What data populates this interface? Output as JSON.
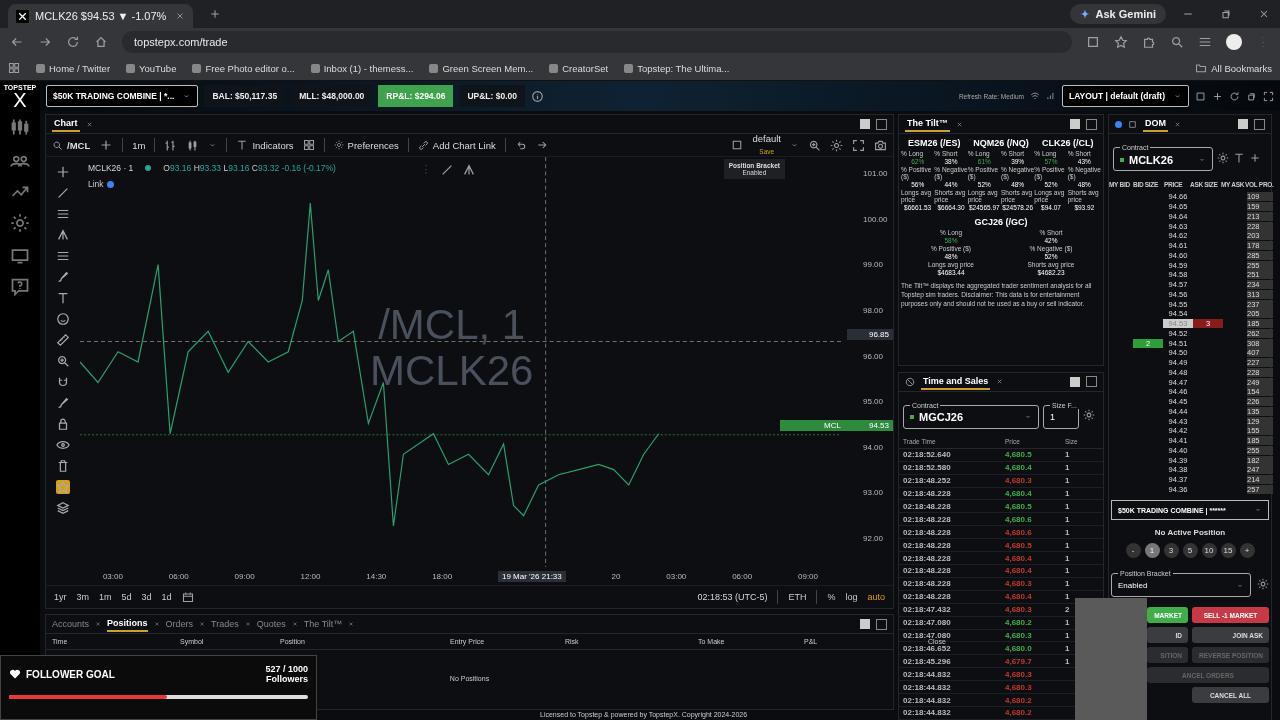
{
  "browser": {
    "tab_title": "MCLK26 $94.53 ▼ -1.07%",
    "ask_button": "Ask Gemini",
    "url": "topstepx.com/trade",
    "bookmarks": [
      "Home / Twitter",
      "YouTube",
      "Free Photo editor o...",
      "Inbox (1) - themess...",
      "Green Screen Mem...",
      "CreatorSet",
      "Topstep: The Ultima..."
    ],
    "all_bookmarks": "All Bookmarks"
  },
  "app_header": {
    "logo_word": "TOPSTEP",
    "logo_letter": "X",
    "account_select": "$50K TRADING COMBINE | *...",
    "stats": [
      {
        "text": "BAL: $50,117.35",
        "kind": "plain"
      },
      {
        "text": "MLL: $48,000.00",
        "kind": "plain"
      },
      {
        "text": "RP&L: $294.06",
        "kind": "positive"
      },
      {
        "text": "UP&L: $0.00",
        "kind": "plain"
      }
    ],
    "refresh_rate": "Refresh Rate: Medium",
    "layout_select": "LAYOUT | default (draft)"
  },
  "chart_panel": {
    "tab": "Chart",
    "symbol": "/MCL",
    "interval": "1m",
    "indicators": "Indicators",
    "preferences": "Preferences",
    "add_link": "Add Chart Link",
    "layout": "default",
    "save": "Save",
    "legend_title": "MCLK26 · 1",
    "ohlc": [
      {
        "label": "O",
        "value": "93.16"
      },
      {
        "label": "H",
        "value": "93.33"
      },
      {
        "label": "L",
        "value": "93.16"
      },
      {
        "label": "C",
        "value": "93.32"
      }
    ],
    "change": "-0.16 (-0.17%)",
    "link": "Link",
    "watermark": [
      "/MCL, 1",
      "MCLK26"
    ],
    "tooltip_title": "Position Bracket",
    "tooltip_value": "Enabled",
    "price_axis": [
      "101.00",
      "100.00",
      "99.00",
      "98.00",
      "96.00",
      "95.00",
      "94.00",
      "93.00",
      "92.00"
    ],
    "crosshair_price": "96.85",
    "last_symbol": "MCL",
    "last_price": "94.53",
    "time_axis": [
      "03:00",
      "06:00",
      "09:00",
      "12:00",
      "14:30",
      "18:00",
      "20",
      "03:00",
      "06:00",
      "09:00"
    ],
    "crosshair_time": "19 Mar '26   21:33",
    "ranges": [
      "1yr",
      "3m",
      "1m",
      "5d",
      "3d",
      "1d"
    ],
    "clock": "02:18:53 (UTC-5)",
    "session": "ETH",
    "scale_options": [
      {
        "label": "%",
        "selected": false
      },
      {
        "label": "log",
        "selected": false
      },
      {
        "label": "auto",
        "selected": true
      }
    ]
  },
  "bottom_panel": {
    "tabs": [
      {
        "label": "Accounts",
        "selected": false
      },
      {
        "label": "Positions",
        "selected": true
      },
      {
        "label": "Orders",
        "selected": false
      },
      {
        "label": "Trades",
        "selected": false
      },
      {
        "label": "Quotes",
        "selected": false
      },
      {
        "label": "The Tilt™",
        "selected": false
      }
    ],
    "columns": [
      "Time",
      "Symbol",
      "Position",
      "Entry Price",
      "Risk",
      "To Make",
      "P&L",
      "Close"
    ],
    "empty": "No Positions"
  },
  "follower_goal": {
    "title": "FOLLOWER GOAL",
    "count": "527 / 1000",
    "unit": "Followers",
    "level": 0.527
  },
  "tilt": {
    "title": "The Tilt™",
    "markets": [
      {
        "ticker": "ESM26 (/ES)",
        "stats": [
          {
            "label": "% Long",
            "value": "62%",
            "kind": "long"
          },
          {
            "label": "% Short",
            "value": "38%",
            "kind": "plain"
          },
          {
            "label": "% Positive ($)",
            "value": "56%",
            "kind": "plain"
          },
          {
            "label": "% Negative ($)",
            "value": "44%",
            "kind": "plain"
          },
          {
            "label": "Longs avg price",
            "value": "$6661.53",
            "kind": "plain"
          },
          {
            "label": "Shorts avg price",
            "value": "$6664.30",
            "kind": "plain"
          }
        ]
      },
      {
        "ticker": "NQM26 (/NQ)",
        "stats": [
          {
            "label": "% Long",
            "value": "61%",
            "kind": "long"
          },
          {
            "label": "% Short",
            "value": "39%",
            "kind": "plain"
          },
          {
            "label": "% Positive ($)",
            "value": "52%",
            "kind": "plain"
          },
          {
            "label": "% Negative ($)",
            "value": "48%",
            "kind": "plain"
          },
          {
            "label": "Longs avg price",
            "value": "$24565.97",
            "kind": "plain"
          },
          {
            "label": "Shorts avg price",
            "value": "$24578.26",
            "kind": "plain"
          }
        ]
      },
      {
        "ticker": "CLK26 (/CL)",
        "stats": [
          {
            "label": "% Long",
            "value": "57%",
            "kind": "long"
          },
          {
            "label": "% Short",
            "value": "43%",
            "kind": "plain"
          },
          {
            "label": "% Positive ($)",
            "value": "52%",
            "kind": "plain"
          },
          {
            "label": "% Negative ($)",
            "value": "48%",
            "kind": "plain"
          },
          {
            "label": "Longs avg price",
            "value": "$94.07",
            "kind": "plain"
          },
          {
            "label": "Shorts avg price",
            "value": "$93.92",
            "kind": "plain"
          }
        ]
      },
      {
        "ticker": "GCJ26 (/GC)",
        "stats": [
          {
            "label": "% Long",
            "value": "58%",
            "kind": "long"
          },
          {
            "label": "% Short",
            "value": "42%",
            "kind": "plain"
          },
          {
            "label": "% Positive ($)",
            "value": "48%",
            "kind": "plain"
          },
          {
            "label": "% Negative ($)",
            "value": "52%",
            "kind": "plain"
          },
          {
            "label": "Longs avg price",
            "value": "$4683.44",
            "kind": "plain"
          },
          {
            "label": "Shorts avg price",
            "value": "$4682.23",
            "kind": "plain"
          }
        ]
      }
    ],
    "disclaimer": "The Tilt™ displays the aggregated trader sentiment analysis for all Topstep sim traders. Disclaimer: This data is for entertainment purposes only and should not be used as a buy or sell indicator."
  },
  "time_and_sales": {
    "title": "Time and Sales",
    "contract_label": "Contract",
    "contract": "MGCJ26",
    "size_label": "Size F...",
    "size": "1",
    "columns": [
      "Trade Time",
      "Price",
      "Size"
    ],
    "rows": [
      {
        "time": "02:18:52.640",
        "price": "4,680.5",
        "size": "1",
        "color": "#3fae49"
      },
      {
        "time": "02:18:52.580",
        "price": "4,680.4",
        "size": "1",
        "color": "#3fae49"
      },
      {
        "time": "02:18:48.252",
        "price": "4,680.3",
        "size": "1",
        "color": "#c0392b"
      },
      {
        "time": "02:18:48.228",
        "price": "4,680.4",
        "size": "1",
        "color": "#3fae49"
      },
      {
        "time": "02:18:48.228",
        "price": "4,680.5",
        "size": "1",
        "color": "#3fae49"
      },
      {
        "time": "02:18:48.228",
        "price": "4,680.6",
        "size": "1",
        "color": "#3fae49"
      },
      {
        "time": "02:18:48.228",
        "price": "4,680.6",
        "size": "1",
        "color": "#c0392b"
      },
      {
        "time": "02:18:48.228",
        "price": "4,680.5",
        "size": "1",
        "color": "#c0392b"
      },
      {
        "time": "02:18:48.228",
        "price": "4,680.4",
        "size": "1",
        "color": "#c0392b"
      },
      {
        "time": "02:18:48.228",
        "price": "4,680.4",
        "size": "1",
        "color": "#c0392b"
      },
      {
        "time": "02:18:48.228",
        "price": "4,680.3",
        "size": "1",
        "color": "#c0392b"
      },
      {
        "time": "02:18:48.228",
        "price": "4,680.4",
        "size": "1",
        "color": "#c0392b"
      },
      {
        "time": "02:18:47.432",
        "price": "4,680.3",
        "size": "2",
        "color": "#c0392b"
      },
      {
        "time": "02:18:47.080",
        "price": "4,680.2",
        "size": "1",
        "color": "#3fae49"
      },
      {
        "time": "02:18:47.080",
        "price": "4,680.3",
        "size": "1",
        "color": "#3fae49"
      },
      {
        "time": "02:18:46.652",
        "price": "4,680.0",
        "size": "1",
        "color": "#3fae49"
      },
      {
        "time": "02:18:45.296",
        "price": "4,679.7",
        "size": "1",
        "color": "#c0392b"
      },
      {
        "time": "02:18:44.832",
        "price": "4,680.3",
        "color": "#c0392b"
      },
      {
        "time": "02:18:44.832",
        "price": "4,680.3",
        "color": "#c0392b"
      },
      {
        "time": "02:18:44.832",
        "price": "4,680.2",
        "color": "#c0392b"
      },
      {
        "time": "02:18:44.832",
        "price": "4,680.2",
        "color": "#c0392b"
      }
    ]
  },
  "dom": {
    "title": "DOM",
    "contract_label": "Contract",
    "contract": "MCLK26",
    "columns": [
      "MY BID",
      "BID SIZE",
      "PRICE",
      "ASK SIZE",
      "MY ASK",
      "VOL PRO."
    ],
    "rows": [
      {
        "price": "94.66",
        "vol": "109",
        "current": false
      },
      {
        "price": "94.65",
        "vol": "159",
        "current": false
      },
      {
        "price": "94.64",
        "vol": "213",
        "current": false
      },
      {
        "price": "94.63",
        "vol": "228",
        "current": false
      },
      {
        "price": "94.62",
        "vol": "203",
        "current": false
      },
      {
        "price": "94.61",
        "vol": "178",
        "current": false
      },
      {
        "price": "94.60",
        "vol": "285",
        "current": false
      },
      {
        "price": "94.59",
        "vol": "255",
        "current": false
      },
      {
        "price": "94.58",
        "vol": "251",
        "current": false
      },
      {
        "price": "94.57",
        "vol": "234",
        "current": false
      },
      {
        "price": "94.56",
        "vol": "313",
        "current": false
      },
      {
        "price": "94.55",
        "vol": "237",
        "current": false
      },
      {
        "price": "94.54",
        "vol": "205",
        "current": false
      },
      {
        "price": "94.53",
        "ask": "3",
        "vol": "185",
        "current": true
      },
      {
        "price": "94.52",
        "vol": "262",
        "current": false
      },
      {
        "price": "94.51",
        "bid": "2",
        "vol": "308",
        "current": false
      },
      {
        "price": "94.50",
        "vol": "407",
        "current": false
      },
      {
        "price": "94.49",
        "vol": "227",
        "current": false
      },
      {
        "price": "94.48",
        "vol": "228",
        "current": false
      },
      {
        "price": "94.47",
        "vol": "249",
        "current": false
      },
      {
        "price": "94.46",
        "vol": "154",
        "current": false
      },
      {
        "price": "94.45",
        "vol": "226",
        "current": false
      },
      {
        "price": "94.44",
        "vol": "135",
        "current": false
      },
      {
        "price": "94.43",
        "vol": "129",
        "current": false
      },
      {
        "price": "94.42",
        "vol": "155",
        "current": false
      },
      {
        "price": "94.41",
        "vol": "185",
        "current": false
      },
      {
        "price": "94.40",
        "vol": "255",
        "current": false
      },
      {
        "price": "94.39",
        "vol": "182",
        "current": false
      },
      {
        "price": "94.38",
        "vol": "247",
        "current": false
      },
      {
        "price": "94.37",
        "vol": "214",
        "current": false
      },
      {
        "price": "94.36",
        "vol": "257",
        "current": false
      }
    ],
    "account_select": "$50K TRADING COMBINE | ******",
    "position_status": "No Active Position",
    "quantity_buttons": [
      {
        "label": "-",
        "selected": false
      },
      {
        "label": "1",
        "selected": true
      },
      {
        "label": "3",
        "selected": false
      },
      {
        "label": "5",
        "selected": false
      },
      {
        "label": "10",
        "selected": false
      },
      {
        "label": "15",
        "selected": false
      },
      {
        "label": "+",
        "selected": false
      }
    ],
    "bracket_label": "Position Bracket",
    "bracket": "Enabled",
    "actions": [
      {
        "label": "MARKET",
        "kind": "buy"
      },
      {
        "label": "SELL -1 MARKET",
        "kind": "sell"
      },
      {
        "label": "ID",
        "kind": "neutral"
      },
      {
        "label": "JOIN ASK",
        "kind": "neutral"
      },
      {
        "label": "SITION",
        "kind": "disabled"
      },
      {
        "label": "REVERSE POSITION",
        "kind": "disabled"
      },
      {
        "label": "ANCEL ORDERS",
        "kind": "wide"
      },
      {
        "label": "CANCEL ALL",
        "kind": "right"
      }
    ]
  },
  "footer": "Licensed to Topstep & powered by TopstepX. Copyright 2024-2026"
}
